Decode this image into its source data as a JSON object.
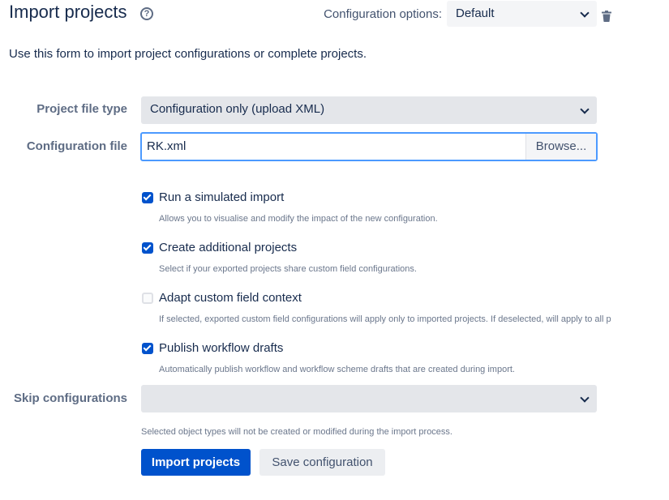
{
  "header": {
    "title": "Import projects",
    "help_icon": "question-circle-icon",
    "config_options_label": "Configuration options:",
    "config_options_value": "Default",
    "delete_icon": "trash-icon"
  },
  "intro": "Use this form to import project configurations or complete projects.",
  "form": {
    "project_file_type": {
      "label": "Project file type",
      "value": "Configuration only (upload XML)"
    },
    "configuration_file": {
      "label": "Configuration file",
      "value": "RK.xml",
      "browse_label": "Browse..."
    },
    "options": [
      {
        "label": "Run a simulated import",
        "description": "Allows you to visualise and modify the impact of the new configuration.",
        "checked": true
      },
      {
        "label": "Create additional projects",
        "description": "Select if your exported projects share custom field configurations.",
        "checked": true
      },
      {
        "label": "Adapt custom field context",
        "description": "If selected, exported custom field configurations will apply only to imported projects. If deselected, will apply to all p",
        "checked": false
      },
      {
        "label": "Publish workflow drafts",
        "description": "Automatically publish workflow and workflow scheme drafts that are created during import.",
        "checked": true
      }
    ],
    "skip_configurations": {
      "label": "Skip configurations",
      "value": "",
      "help": "Selected object types will not be created or modified during the import process."
    }
  },
  "actions": {
    "import_label": "Import projects",
    "save_label": "Save configuration"
  },
  "colors": {
    "primary": "#0052cc",
    "focus_border": "#4c9aff",
    "text": "#172b4d",
    "muted": "#6b778c"
  }
}
